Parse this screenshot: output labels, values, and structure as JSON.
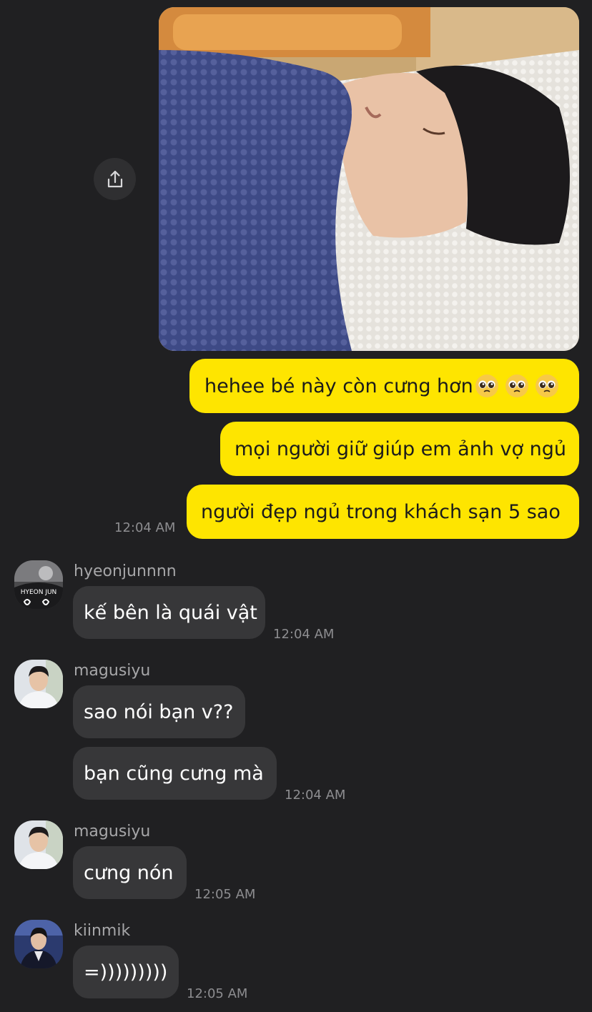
{
  "photo": {
    "alt": ""
  },
  "share": {
    "icon": "share-icon"
  },
  "outgoing": {
    "messages": [
      {
        "text": "hehee bé này còn cưng hơn",
        "emoji": [
          "pleading-face-emoji",
          "pleading-face-emoji",
          "pleading-face-emoji"
        ]
      },
      {
        "text": "mọi người giữ giúp em ảnh vợ ngủ"
      },
      {
        "text": "người đẹp ngủ trong khách sạn 5 sao"
      }
    ],
    "time": "12:04 AM"
  },
  "groups": [
    {
      "sender": "hyeonjunnnn",
      "messages": [
        "kế bên là quái vật"
      ],
      "time": "12:04 AM"
    },
    {
      "sender": "magusiyu",
      "messages": [
        "sao nói bạn v??",
        "bạn cũng cưng mà"
      ],
      "time": "12:04 AM"
    },
    {
      "sender": "magusiyu",
      "messages": [
        "cưng nón"
      ],
      "time": "12:05 AM"
    },
    {
      "sender": "kiinmik",
      "messages": [
        "=)))))))))"
      ],
      "time": "12:05 AM"
    }
  ],
  "avatar_texts": {
    "hyeonjun_jersey": "HYEON JUN"
  },
  "colors": {
    "background": "#202022",
    "outgoing_bubble": "#fee500",
    "incoming_bubble": "#373739",
    "timestamp": "#8d8d90"
  }
}
